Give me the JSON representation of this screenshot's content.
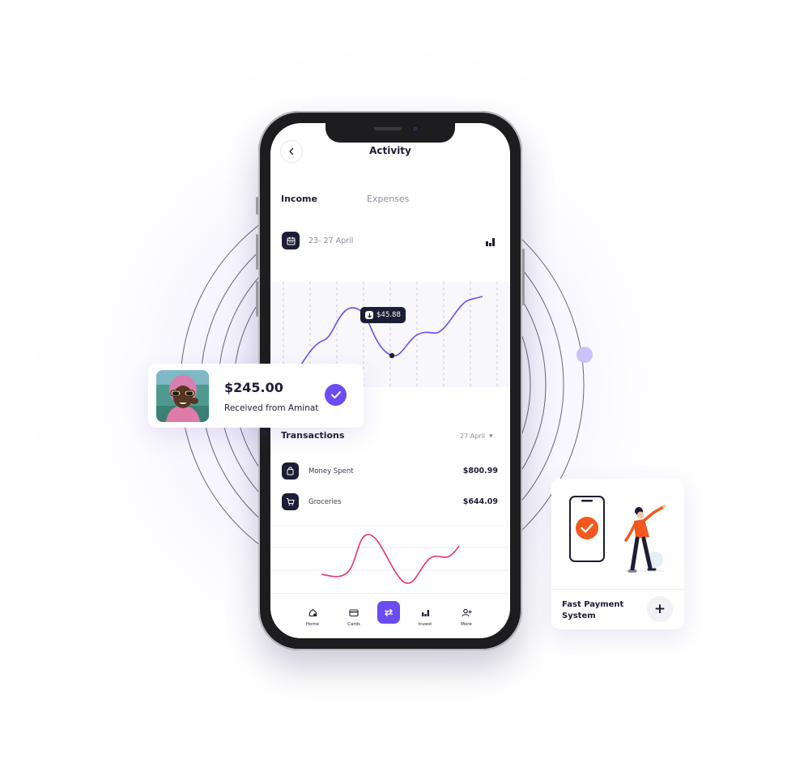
{
  "app": {
    "title": "Activity",
    "tabs": [
      {
        "label": "Income",
        "active": true
      },
      {
        "label": "Expenses",
        "active": false
      }
    ],
    "date_range": "23- 27 April",
    "chart": {
      "tooltip_value": "$45.88",
      "line_color": "#6c4cf0"
    },
    "transactions": {
      "title": "Transactions",
      "date_filter": "27 April",
      "items": [
        {
          "label": "Money Spent",
          "amount": "$800.99",
          "icon": "shopping-bag-icon"
        },
        {
          "label": "Groceries",
          "amount": "$644.09",
          "icon": "cart-icon"
        }
      ]
    },
    "bottom_chart": {
      "line_color": "#e8336d"
    },
    "nav": [
      {
        "label": "Home",
        "icon": "home-icon"
      },
      {
        "label": "Cards",
        "icon": "card-icon"
      },
      {
        "label": "",
        "icon": "transfer-icon"
      },
      {
        "label": "Invest",
        "icon": "chart-icon"
      },
      {
        "label": "More",
        "icon": "user-add-icon"
      }
    ]
  },
  "received_card": {
    "amount": "$245.00",
    "subtitle": "Received from Aminat",
    "status": "check-icon"
  },
  "payment_card": {
    "title": "Fast Payment System",
    "action": "+"
  },
  "colors": {
    "accent": "#6c4cf0",
    "dark": "#1d1d35",
    "pink": "#e8336d",
    "orange": "#f4581e"
  }
}
